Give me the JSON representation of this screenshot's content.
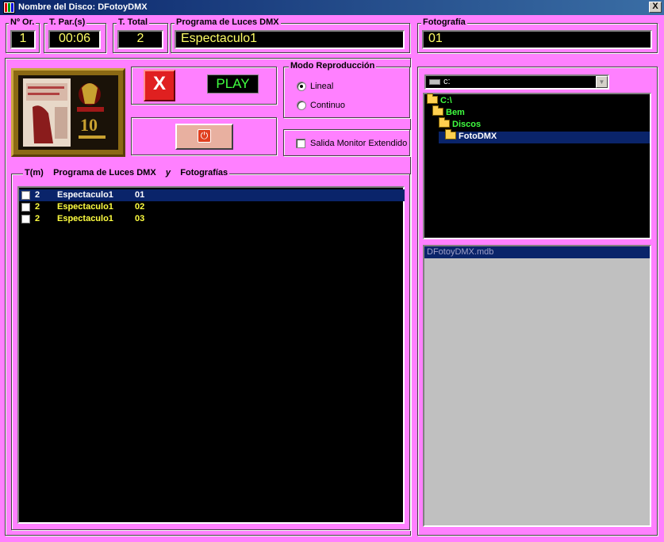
{
  "window": {
    "title": "Nombre del Disco: DFotoyDMX",
    "close_label": "X"
  },
  "header": {
    "num_order": {
      "label": "Nº Or.",
      "value": "1"
    },
    "t_partial": {
      "label": "T. Par.(s)",
      "value": "00:06"
    },
    "t_total": {
      "label": "T. Total",
      "value": "2"
    },
    "program": {
      "label": "Programa de Luces DMX",
      "value": "Espectaculo1"
    },
    "photo": {
      "label": "Fotografía",
      "value": "01"
    }
  },
  "controls": {
    "stop_label": "X",
    "play_label": "PLAY",
    "power_label": "⏻"
  },
  "mode": {
    "label": "Modo Reproducción",
    "options": [
      {
        "label": "Lineal",
        "selected": true
      },
      {
        "label": "Continuo",
        "selected": false
      }
    ]
  },
  "monitor": {
    "label": "Salida Monitor Extendido",
    "checked": false
  },
  "playlist": {
    "legend": {
      "t": "T(m)",
      "program": "Programa de Luces DMX",
      "and": "y",
      "photos": "Fotografías"
    },
    "rows": [
      {
        "t": "2",
        "program": "Espectaculo1",
        "photo": "01",
        "selected": true,
        "color": "#ffffff"
      },
      {
        "t": "2",
        "program": "Espectaculo1",
        "photo": "02",
        "selected": false,
        "color": "#ffff40"
      },
      {
        "t": "2",
        "program": "Espectaculo1",
        "photo": "03",
        "selected": false,
        "color": "#ffff40"
      }
    ]
  },
  "drive": {
    "value": "c:",
    "arrow": "▼"
  },
  "directories": [
    {
      "name": "C:\\",
      "selected": false
    },
    {
      "name": "Bem",
      "selected": false
    },
    {
      "name": "Discos",
      "selected": false
    },
    {
      "name": "FotoDMX",
      "selected": true
    }
  ],
  "files": [
    {
      "name": "DFotoyDMX.mdb",
      "selected": true
    }
  ],
  "colors": {
    "background": "#ff80ff",
    "lcd_text": "#ffff66",
    "play_text": "#40ff40",
    "selection": "#0a246a"
  }
}
